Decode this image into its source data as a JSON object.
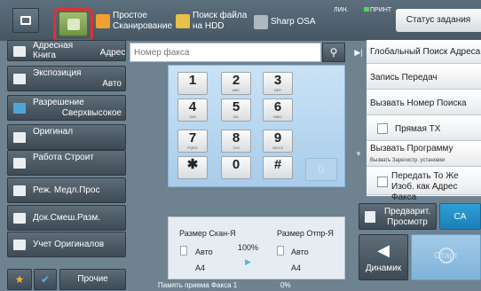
{
  "topbar": {
    "simple_scan": "Простое Сканирование",
    "hdd_search": "Поиск файла на HDD",
    "sharp_osa": "Sharp OSA",
    "line_ind": "ЛИН.",
    "print_ind": "ПРИНТ",
    "status": "Статус задания"
  },
  "left": {
    "address_book": "Адресная Книга",
    "exposure": "Экспозиция",
    "exposure_val": "Авто",
    "resolution": "Разрешение",
    "resolution_val": "Сверхвысокое",
    "original": "Оригинал",
    "job_build": "Работа Строит",
    "slow_scan": "Реж. Медл.Прос",
    "mixed_doc": "Док.Смеш.Разм.",
    "count_originals": "Учет Оригиналов",
    "other": "Прочие"
  },
  "address": {
    "label": "Адрес",
    "placeholder": "Номер факса"
  },
  "keypad": [
    {
      "d": "1",
      "l": ""
    },
    {
      "d": "2",
      "l": "ABC"
    },
    {
      "d": "3",
      "l": "DEF"
    },
    {
      "d": "4",
      "l": "GHI"
    },
    {
      "d": "5",
      "l": "JKL"
    },
    {
      "d": "6",
      "l": "MNO"
    },
    {
      "d": "7",
      "l": "PQRS"
    },
    {
      "d": "8",
      "l": "TUV"
    },
    {
      "d": "9",
      "l": "WXYZ"
    },
    {
      "d": "✱",
      "l": ""
    },
    {
      "d": "0",
      "l": ""
    },
    {
      "d": "#",
      "l": ""
    }
  ],
  "size": {
    "scan_size": "Размер Скан-Я",
    "send_size": "Размер Отпр-Я",
    "auto1": "Авто",
    "auto2": "Авто",
    "ratio": "100%",
    "a4_1": "A4",
    "a4_2": "A4",
    "memory_label": "Память приема Факса",
    "memory_num": "1",
    "memory_pct": "0%"
  },
  "right": {
    "global_search": "Глобальный Поиск Адреса",
    "tx_log": "Запись Передач",
    "call_search": "Вызвать Номер Поиска",
    "direct_tx": "Прямая TX",
    "call_program": "Вызвать Программу",
    "call_program_sub": "Вызвать Зарегистр. установки",
    "same_image": "Передать То Же Изоб. как Адрес Факса"
  },
  "bottom": {
    "preview": "Предварит. Просмотр",
    "ca": "CA",
    "speaker": "Динамик",
    "start": "Старт"
  },
  "colors": {
    "accent": "#2e9fd6",
    "highlight": "#e23030"
  }
}
